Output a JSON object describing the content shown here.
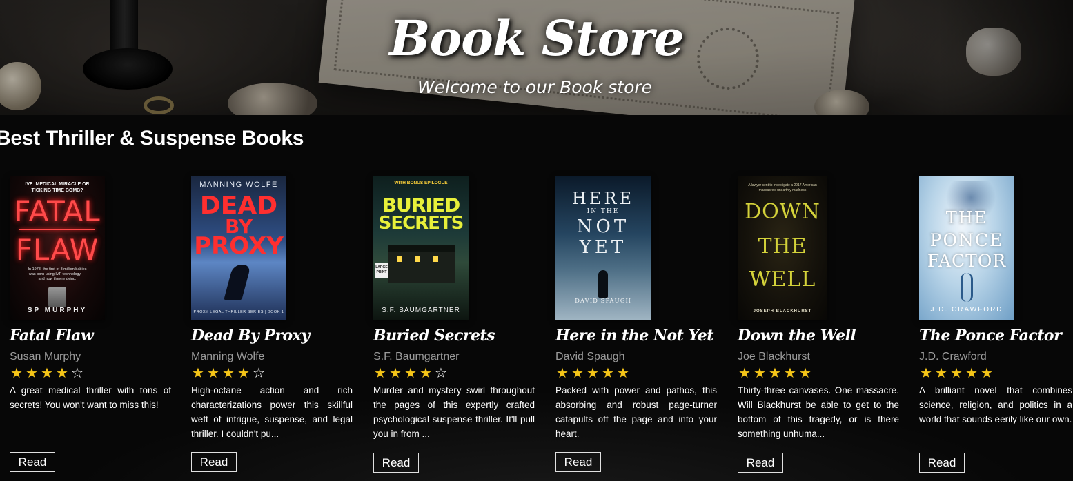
{
  "hero": {
    "title": "Book Store",
    "subtitle": "Welcome to our Book store"
  },
  "section": {
    "title": "Best Thriller & Suspense Books"
  },
  "books": [
    {
      "title": "Fatal Flaw",
      "author": "Susan Murphy",
      "rating": 4,
      "description": "A great medical thriller with tons of secrets! You won't want to miss this!",
      "button_label": "Read",
      "cover": {
        "top_text": "IVF: MEDICAL MIRACLE OR TICKING TIME BOMB?",
        "title_line1": "FATAL",
        "title_line2": "FLAW",
        "blurb": "In 1978, the first of 8 million babies was born using IVF technology —and now they're dying.",
        "author": "SP MURPHY",
        "accent": "#ff3b3b"
      }
    },
    {
      "title": "Dead By Proxy",
      "author": "Manning Wolfe",
      "rating": 4,
      "description": "High-octane action and rich characterizations power this skillful weft of intrigue, suspense, and legal thriller. I couldn't pu...",
      "button_label": "Read",
      "cover": {
        "top_text": "MANNING WOLFE",
        "title_line1": "DEAD",
        "title_line2": "BY",
        "title_line3": "PROXY",
        "bottom_text": "PROXY LEGAL THRILLER SERIES | BOOK 1",
        "accent": "#ff2a2a"
      }
    },
    {
      "title": "Buried Secrets",
      "author": "S.F. Baumgartner",
      "rating": 4,
      "description": "Murder and mystery swirl throughout the pages of this expertly crafted psychological suspense thriller. It'll pull you in from ...",
      "button_label": "Read",
      "cover": {
        "top_text": "WITH BONUS EPILOGUE",
        "title_line1": "BURIED",
        "title_line2": "SECRETS",
        "badge": "LARGE PRINT",
        "author": "S.F. BAUMGARTNER",
        "accent": "#e8f03a"
      }
    },
    {
      "title": "Here in the Not Yet",
      "author": "David Spaugh",
      "rating": 5,
      "description": "Packed with power and pathos, this absorbing and robust page-turner catapults off the page and into your heart.",
      "button_label": "Read",
      "cover": {
        "title_line1": "HERE",
        "title_line2": "IN THE",
        "title_line3": "NOT",
        "title_line4": "YET",
        "author": "DAVID SPAUGH",
        "accent": "#e8eef2"
      }
    },
    {
      "title": "Down the Well",
      "author": "Joe Blackhurst",
      "rating": 5,
      "description": "Thirty-three canvases. One massacre. Will Blackhurst be able to get to the bottom of this tragedy, or is there something unhuma...",
      "button_label": "Read",
      "cover": {
        "top_text": "A lawyer sent to investigate a 2017 American massacre's unearthly madness",
        "title_line1": "DOWN",
        "title_line2": "THE",
        "title_line3": "WELL",
        "author": "JOSEPH BLACKHURST",
        "accent": "#d4d23a"
      }
    },
    {
      "title": "The Ponce Factor",
      "author": "J.D. Crawford",
      "rating": 5,
      "description": "A brilliant novel that combines science, religion, and politics in a world that sounds eerily like our own.",
      "button_label": "Read",
      "cover": {
        "title_line1": "THE",
        "title_line2": "PONCE",
        "title_line3": "FACTOR",
        "author": "J.D. CRAWFORD",
        "accent": "#ffffff"
      }
    }
  ],
  "icons": {
    "star_filled": "star-filled-icon",
    "star_empty": "star-outline-icon"
  },
  "colors": {
    "star": "#f5c518",
    "author_text": "#9a9a9a",
    "background": "#060606"
  }
}
